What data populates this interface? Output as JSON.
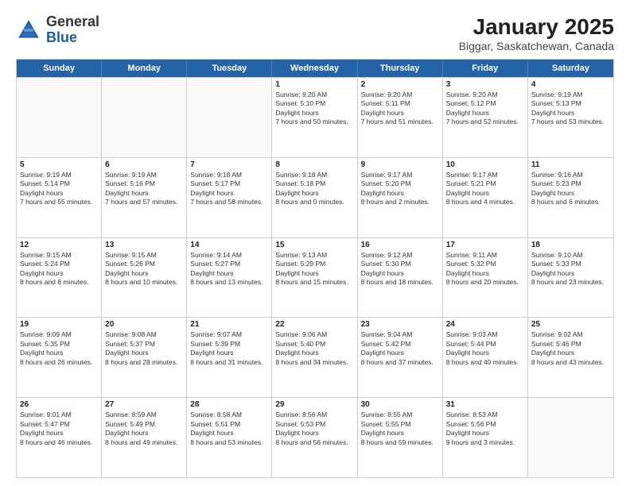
{
  "logo": {
    "general": "General",
    "blue": "Blue"
  },
  "title": "January 2025",
  "subtitle": "Biggar, Saskatchewan, Canada",
  "days": [
    "Sunday",
    "Monday",
    "Tuesday",
    "Wednesday",
    "Thursday",
    "Friday",
    "Saturday"
  ],
  "weeks": [
    [
      {
        "day": "",
        "empty": true
      },
      {
        "day": "",
        "empty": true
      },
      {
        "day": "",
        "empty": true
      },
      {
        "day": "1",
        "sunrise": "9:20 AM",
        "sunset": "5:10 PM",
        "daylight": "7 hours and 50 minutes."
      },
      {
        "day": "2",
        "sunrise": "9:20 AM",
        "sunset": "5:11 PM",
        "daylight": "7 hours and 51 minutes."
      },
      {
        "day": "3",
        "sunrise": "9:20 AM",
        "sunset": "5:12 PM",
        "daylight": "7 hours and 52 minutes."
      },
      {
        "day": "4",
        "sunrise": "9:19 AM",
        "sunset": "5:13 PM",
        "daylight": "7 hours and 53 minutes."
      }
    ],
    [
      {
        "day": "5",
        "sunrise": "9:19 AM",
        "sunset": "5:14 PM",
        "daylight": "7 hours and 55 minutes."
      },
      {
        "day": "6",
        "sunrise": "9:19 AM",
        "sunset": "5:16 PM",
        "daylight": "7 hours and 57 minutes."
      },
      {
        "day": "7",
        "sunrise": "9:18 AM",
        "sunset": "5:17 PM",
        "daylight": "7 hours and 58 minutes."
      },
      {
        "day": "8",
        "sunrise": "9:18 AM",
        "sunset": "5:18 PM",
        "daylight": "8 hours and 0 minutes."
      },
      {
        "day": "9",
        "sunrise": "9:17 AM",
        "sunset": "5:20 PM",
        "daylight": "8 hours and 2 minutes."
      },
      {
        "day": "10",
        "sunrise": "9:17 AM",
        "sunset": "5:21 PM",
        "daylight": "8 hours and 4 minutes."
      },
      {
        "day": "11",
        "sunrise": "9:16 AM",
        "sunset": "5:23 PM",
        "daylight": "8 hours and 6 minutes."
      }
    ],
    [
      {
        "day": "12",
        "sunrise": "9:15 AM",
        "sunset": "5:24 PM",
        "daylight": "8 hours and 8 minutes."
      },
      {
        "day": "13",
        "sunrise": "9:15 AM",
        "sunset": "5:26 PM",
        "daylight": "8 hours and 10 minutes."
      },
      {
        "day": "14",
        "sunrise": "9:14 AM",
        "sunset": "5:27 PM",
        "daylight": "8 hours and 13 minutes."
      },
      {
        "day": "15",
        "sunrise": "9:13 AM",
        "sunset": "5:29 PM",
        "daylight": "8 hours and 15 minutes."
      },
      {
        "day": "16",
        "sunrise": "9:12 AM",
        "sunset": "5:30 PM",
        "daylight": "8 hours and 18 minutes."
      },
      {
        "day": "17",
        "sunrise": "9:11 AM",
        "sunset": "5:32 PM",
        "daylight": "8 hours and 20 minutes."
      },
      {
        "day": "18",
        "sunrise": "9:10 AM",
        "sunset": "5:33 PM",
        "daylight": "8 hours and 23 minutes."
      }
    ],
    [
      {
        "day": "19",
        "sunrise": "9:09 AM",
        "sunset": "5:35 PM",
        "daylight": "8 hours and 26 minutes."
      },
      {
        "day": "20",
        "sunrise": "9:08 AM",
        "sunset": "5:37 PM",
        "daylight": "8 hours and 28 minutes."
      },
      {
        "day": "21",
        "sunrise": "9:07 AM",
        "sunset": "5:39 PM",
        "daylight": "8 hours and 31 minutes."
      },
      {
        "day": "22",
        "sunrise": "9:06 AM",
        "sunset": "5:40 PM",
        "daylight": "8 hours and 34 minutes."
      },
      {
        "day": "23",
        "sunrise": "9:04 AM",
        "sunset": "5:42 PM",
        "daylight": "8 hours and 37 minutes."
      },
      {
        "day": "24",
        "sunrise": "9:03 AM",
        "sunset": "5:44 PM",
        "daylight": "8 hours and 40 minutes."
      },
      {
        "day": "25",
        "sunrise": "9:02 AM",
        "sunset": "5:46 PM",
        "daylight": "8 hours and 43 minutes."
      }
    ],
    [
      {
        "day": "26",
        "sunrise": "9:01 AM",
        "sunset": "5:47 PM",
        "daylight": "8 hours and 46 minutes."
      },
      {
        "day": "27",
        "sunrise": "8:59 AM",
        "sunset": "5:49 PM",
        "daylight": "8 hours and 49 minutes."
      },
      {
        "day": "28",
        "sunrise": "8:58 AM",
        "sunset": "5:51 PM",
        "daylight": "8 hours and 53 minutes."
      },
      {
        "day": "29",
        "sunrise": "8:56 AM",
        "sunset": "5:53 PM",
        "daylight": "8 hours and 56 minutes."
      },
      {
        "day": "30",
        "sunrise": "8:55 AM",
        "sunset": "5:55 PM",
        "daylight": "8 hours and 59 minutes."
      },
      {
        "day": "31",
        "sunrise": "8:53 AM",
        "sunset": "5:56 PM",
        "daylight": "9 hours and 3 minutes."
      },
      {
        "day": "",
        "empty": true
      }
    ]
  ]
}
